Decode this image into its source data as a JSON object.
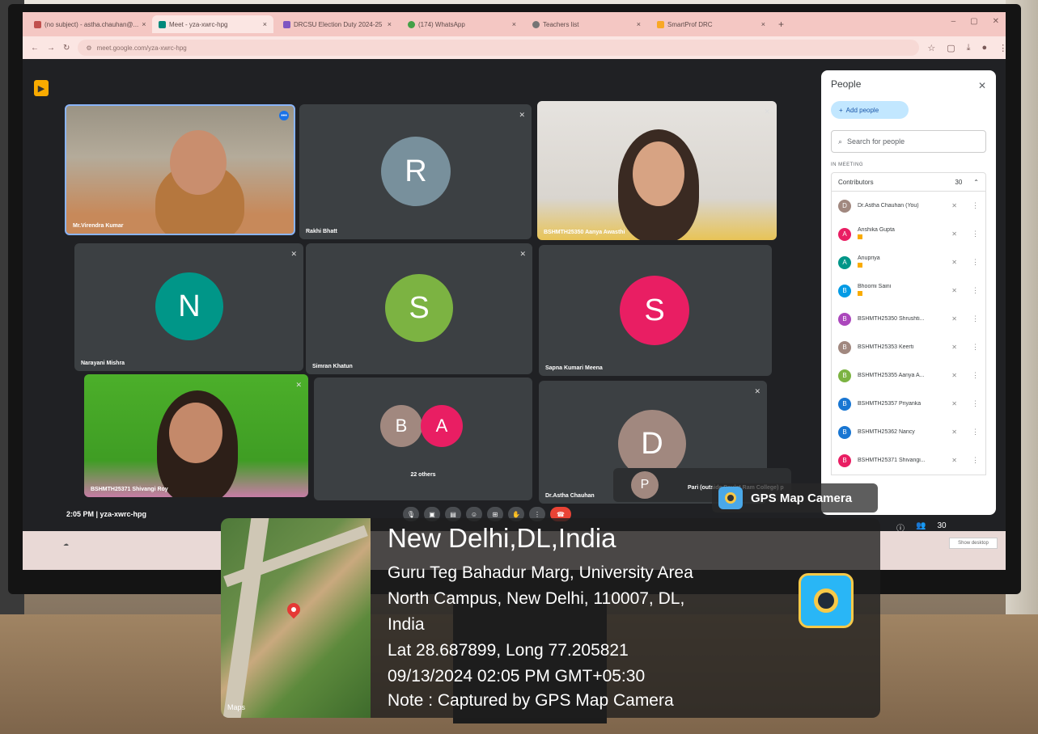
{
  "browser": {
    "tabs": [
      {
        "label": "(no subject) - astha.chauhan@...",
        "active": false
      },
      {
        "label": "Meet - yza-xwrc-hpg",
        "active": true
      },
      {
        "label": "DRCSU Election Duty 2024-25",
        "active": false
      },
      {
        "label": "(174) WhatsApp",
        "active": false
      },
      {
        "label": "Teachers list",
        "active": false
      },
      {
        "label": "SmartProf DRC",
        "active": false
      }
    ],
    "url": "meet.google.com/yza-xwrc-hpg"
  },
  "meet": {
    "tiles": [
      {
        "name": "Mr.Virendra Kumar",
        "type": "video"
      },
      {
        "name": "Rakhi Bhatt",
        "initial": "R",
        "color": "#78909c"
      },
      {
        "name": "BSHMTH25350 Aanya Awasthi",
        "type": "video"
      },
      {
        "name": "Narayani Mishra",
        "initial": "N",
        "color": "#009688"
      },
      {
        "name": "Simran Khatun",
        "initial": "S",
        "color": "#7cb342"
      },
      {
        "name": "Sapna Kumari Meena",
        "initial": "S",
        "color": "#e91e63"
      },
      {
        "name": "BSHMTH25371 Shivangi Roy",
        "type": "video"
      },
      {
        "name": "22 others",
        "initials": [
          "B",
          "A"
        ],
        "colors": [
          "#a1887f",
          "#e91e63"
        ]
      },
      {
        "name": "Dr.Astha Chauhan",
        "initial": "D",
        "color": "#a1887f"
      }
    ],
    "presenting": {
      "initial": "P",
      "name": "Pari (outside Daulat Ram College) p"
    },
    "meeting_info": "2:05 PM | yza-xwrc-hpg",
    "participant_count": "30"
  },
  "people_panel": {
    "title": "People",
    "add_people": "Add people",
    "search_placeholder": "Search for people",
    "in_meeting": "IN MEETING",
    "contributors_label": "Contributors",
    "contributors_count": "30",
    "participants": [
      {
        "initial": "D",
        "name": "Dr.Astha Chauhan (You)",
        "color": "#a1887f"
      },
      {
        "initial": "A",
        "name": "Anshika Gupta",
        "color": "#e91e63"
      },
      {
        "initial": "A",
        "name": "Anupriya",
        "color": "#009688"
      },
      {
        "initial": "B",
        "name": "Bhoomi Saini",
        "color": "#039be5"
      },
      {
        "initial": "B",
        "name": "BSHMTH25350 Shrushti...",
        "color": "#ab47bc"
      },
      {
        "initial": "B",
        "name": "BSHMTH25353 Keerti",
        "color": "#a1887f"
      },
      {
        "initial": "B",
        "name": "BSHMTH25355 Aanya A...",
        "color": "#7cb342"
      },
      {
        "initial": "B",
        "name": "BSHMTH25357 Priyanka",
        "color": "#1976d2"
      },
      {
        "initial": "B",
        "name": "BSHMTH25362 Nancy",
        "color": "#1976d2"
      },
      {
        "initial": "B",
        "name": "BSHMTH25371 Shivangi...",
        "color": "#e91e63"
      }
    ]
  },
  "taskbar": {
    "show_desktop": "Show desktop"
  },
  "gps": {
    "tag": "GPS Map Camera",
    "city": "New Delhi,DL,India",
    "address_line1": "Guru Teg Bahadur Marg, University Area",
    "address_line2": "North Campus, New Delhi, 110007, DL,",
    "address_line3": "India",
    "coords": "Lat 28.687899, Long 77.205821",
    "datetime": "09/13/2024 02:05 PM GMT+05:30",
    "note": "Note : Captured by GPS Map Camera",
    "map_label": "Maps"
  }
}
